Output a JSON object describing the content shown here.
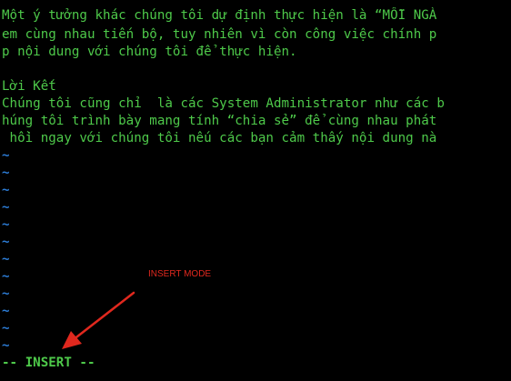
{
  "editor": {
    "lines": [
      "Một ý tưởng khác chúng tôi dự định thực hiện là “MỖI NGÀ",
      "em cùng nhau tiến bộ, tuy nhiên vì còn công việc chính p",
      "p nội dung với chúng tôi để thực hiện.",
      "",
      "Lời Kết",
      "Chúng tôi cũng chỉ  là các System Administrator như các b",
      "húng tôi trình bày mang tính “chia sẻ” để cùng nhau phát",
      " hồi ngay với chúng tôi nếu các bạn cảm thấy nội dung nà"
    ],
    "tilde_marker": "~",
    "mode_label": "-- INSERT --"
  },
  "annotation": {
    "label": "INSERT MODE",
    "color": "#e0281e"
  },
  "colors": {
    "background": "#000000",
    "text": "#4ec94a",
    "tilde": "#2c7bd4"
  }
}
